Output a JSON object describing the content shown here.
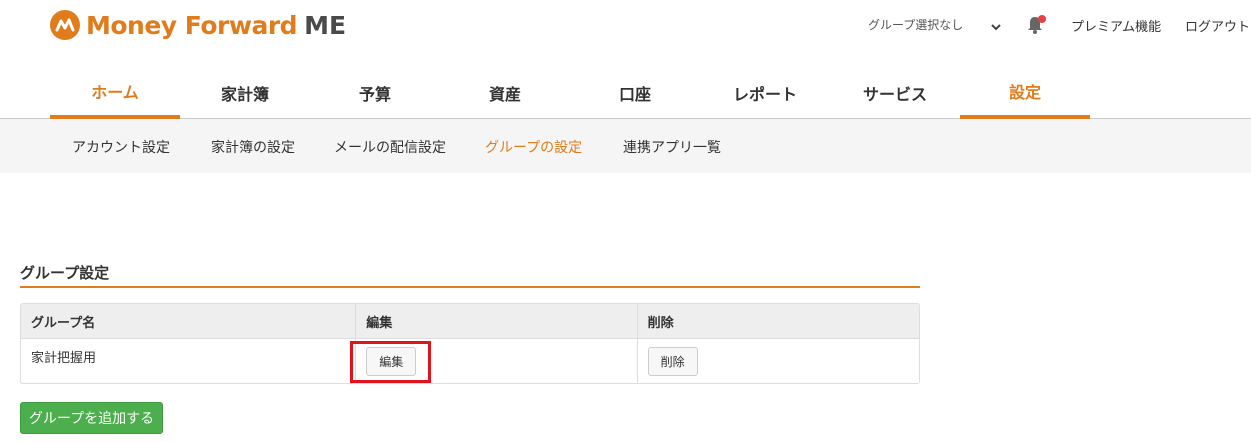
{
  "header": {
    "logo_text": "Money Forward",
    "logo_suffix": "ME",
    "group_select": "グループ選択なし",
    "premium": "プレミアム機能",
    "logout": "ログアウト"
  },
  "main_nav": [
    {
      "label": "ホーム",
      "active": false
    },
    {
      "label": "家計簿",
      "active": false
    },
    {
      "label": "予算",
      "active": false
    },
    {
      "label": "資産",
      "active": false
    },
    {
      "label": "口座",
      "active": false
    },
    {
      "label": "レポート",
      "active": false
    },
    {
      "label": "サービス",
      "active": false
    },
    {
      "label": "設定",
      "active": true
    }
  ],
  "sub_nav": [
    {
      "label": "アカウント設定",
      "active": false
    },
    {
      "label": "家計簿の設定",
      "active": false
    },
    {
      "label": "メールの配信設定",
      "active": false
    },
    {
      "label": "グループの設定",
      "active": true
    },
    {
      "label": "連携アプリ一覧",
      "active": false
    }
  ],
  "section": {
    "title": "グループ設定",
    "table": {
      "headers": [
        "グループ名",
        "編集",
        "削除"
      ],
      "rows": [
        {
          "name": "家計把握用",
          "edit_label": "編集",
          "delete_label": "削除"
        }
      ]
    },
    "add_button": "グループを追加する"
  },
  "colors": {
    "brand_orange": "#e07c1c",
    "add_green": "#4cae4c",
    "highlight_red": "#e0121b"
  }
}
